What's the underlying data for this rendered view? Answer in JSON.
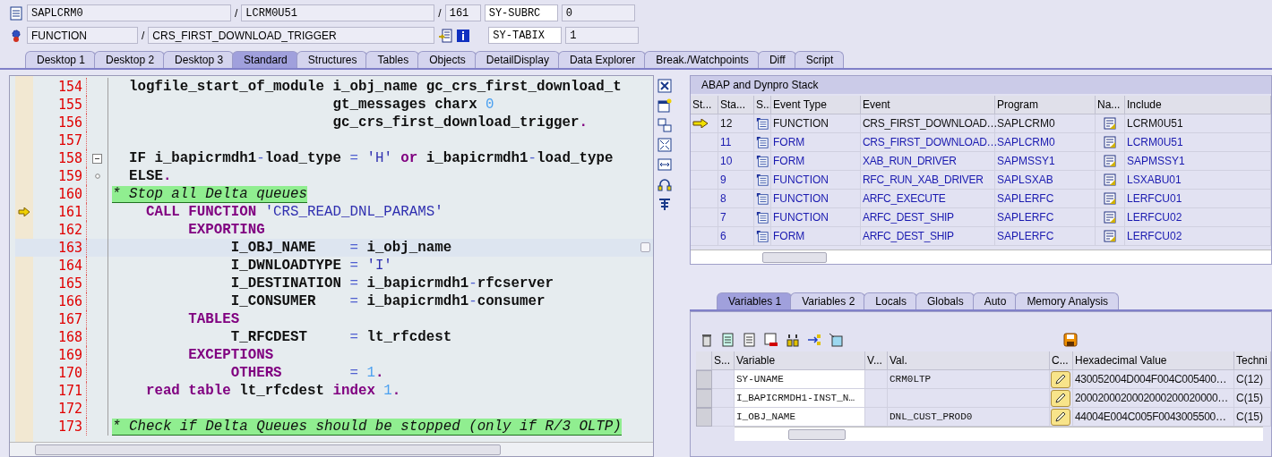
{
  "header": {
    "program": "SAPLCRM0",
    "include": "LCRM0U51",
    "line": "161",
    "sep1": "/",
    "sep2": "/",
    "sep3": "/",
    "event_type": "FUNCTION",
    "event": "CRS_FIRST_DOWNLOAD_TRIGGER",
    "sysvars": [
      {
        "name": "SY-SUBRC",
        "value": "0"
      },
      {
        "name": "SY-TABIX",
        "value": "1"
      }
    ]
  },
  "tabs": [
    {
      "label": "Desktop 1",
      "selected": false
    },
    {
      "label": "Desktop 2",
      "selected": false
    },
    {
      "label": "Desktop 3",
      "selected": false
    },
    {
      "label": "Standard",
      "selected": true
    },
    {
      "label": "Structures",
      "selected": false
    },
    {
      "label": "Tables",
      "selected": false
    },
    {
      "label": "Objects",
      "selected": false
    },
    {
      "label": "DetailDisplay",
      "selected": false
    },
    {
      "label": "Data Explorer",
      "selected": false
    },
    {
      "label": "Break./Watchpoints",
      "selected": false
    },
    {
      "label": "Diff",
      "selected": false
    },
    {
      "label": "Script",
      "selected": false
    }
  ],
  "editor": {
    "lines": [
      {
        "number": "154",
        "current": false,
        "fold_start": false,
        "fold_end": false,
        "selected": false,
        "tokens": [
          {
            "kind": "plain",
            "text": "  logfile_start_of_module i_obj_name gc_crs_first_download_t"
          }
        ]
      },
      {
        "number": "155",
        "current": false,
        "fold_start": false,
        "fold_end": false,
        "selected": false,
        "tokens": [
          {
            "kind": "plain",
            "text": "                          gt_messages charx"
          },
          {
            "kind": "num",
            "text": " 0"
          }
        ]
      },
      {
        "number": "156",
        "current": false,
        "fold_start": false,
        "fold_end": false,
        "selected": false,
        "tokens": [
          {
            "kind": "plain",
            "text": "                          gc_crs_first_download_trigger"
          },
          {
            "kind": "kw",
            "text": "."
          }
        ]
      },
      {
        "number": "157",
        "current": false,
        "fold_start": false,
        "fold_end": false,
        "selected": false
      },
      {
        "number": "158",
        "current": false,
        "fold_start": true,
        "fold_end": false,
        "selected": false,
        "tokens": [
          {
            "kind": "plain",
            "text": "  IF i_bapicrmdh1"
          },
          {
            "kind": "op",
            "text": "-"
          },
          {
            "kind": "plain",
            "text": "load_type"
          },
          {
            "kind": "op",
            "text": " ="
          },
          {
            "kind": "str",
            "text": " 'H'"
          },
          {
            "kind": "kw",
            "text": " or"
          },
          {
            "kind": "plain",
            "text": " i_bapicrmdh1"
          },
          {
            "kind": "op",
            "text": "-"
          },
          {
            "kind": "plain",
            "text": "load_type"
          }
        ]
      },
      {
        "number": "159",
        "current": false,
        "fold_start": false,
        "fold_end": true,
        "selected": false,
        "tokens": [
          {
            "kind": "plain",
            "text": "  ELSE"
          },
          {
            "kind": "kw",
            "text": "."
          }
        ]
      },
      {
        "number": "160",
        "current": false,
        "fold_start": false,
        "fold_end": false,
        "selected": false,
        "tokens": [
          {
            "kind": "comment",
            "text": "* Stop all Delta queues"
          }
        ]
      },
      {
        "number": "161",
        "current": true,
        "fold_start": false,
        "fold_end": false,
        "selected": false,
        "tokens": [
          {
            "kind": "kw",
            "text": "    CALL FUNCTION"
          },
          {
            "kind": "str",
            "text": " 'CRS_READ_DNL_PARAMS'"
          }
        ]
      },
      {
        "number": "162",
        "current": false,
        "fold_start": false,
        "fold_end": false,
        "selected": false,
        "tokens": [
          {
            "kind": "kw",
            "text": "         EXPORTING"
          }
        ]
      },
      {
        "number": "163",
        "current": false,
        "fold_start": false,
        "fold_end": false,
        "selected": true,
        "tokens": [
          {
            "kind": "plain",
            "text": "              I_OBJ_NAME"
          },
          {
            "kind": "op",
            "text": "    ="
          },
          {
            "kind": "plain",
            "text": " i_obj_name"
          }
        ]
      },
      {
        "number": "164",
        "current": false,
        "fold_start": false,
        "fold_end": false,
        "selected": false,
        "tokens": [
          {
            "kind": "plain",
            "text": "              I_DWNLOADTYPE"
          },
          {
            "kind": "op",
            "text": " ="
          },
          {
            "kind": "str",
            "text": " 'I'"
          }
        ]
      },
      {
        "number": "165",
        "current": false,
        "fold_start": false,
        "fold_end": false,
        "selected": false,
        "tokens": [
          {
            "kind": "plain",
            "text": "              I_DESTINATION"
          },
          {
            "kind": "op",
            "text": " ="
          },
          {
            "kind": "plain",
            "text": " i_bapicrmdh1"
          },
          {
            "kind": "op",
            "text": "-"
          },
          {
            "kind": "plain",
            "text": "rfcserver"
          }
        ]
      },
      {
        "number": "166",
        "current": false,
        "fold_start": false,
        "fold_end": false,
        "selected": false,
        "tokens": [
          {
            "kind": "plain",
            "text": "              I_CONSUMER"
          },
          {
            "kind": "op",
            "text": "    ="
          },
          {
            "kind": "plain",
            "text": " i_bapicrmdh1"
          },
          {
            "kind": "op",
            "text": "-"
          },
          {
            "kind": "plain",
            "text": "consumer"
          }
        ]
      },
      {
        "number": "167",
        "current": false,
        "fold_start": false,
        "fold_end": false,
        "selected": false,
        "tokens": [
          {
            "kind": "kw",
            "text": "         TABLES"
          }
        ]
      },
      {
        "number": "168",
        "current": false,
        "fold_start": false,
        "fold_end": false,
        "selected": false,
        "tokens": [
          {
            "kind": "plain",
            "text": "              T_RFCDEST"
          },
          {
            "kind": "op",
            "text": "     ="
          },
          {
            "kind": "plain",
            "text": " lt_rfcdest"
          }
        ]
      },
      {
        "number": "169",
        "current": false,
        "fold_start": false,
        "fold_end": false,
        "selected": false,
        "tokens": [
          {
            "kind": "kw",
            "text": "         EXCEPTIONS"
          }
        ]
      },
      {
        "number": "170",
        "current": false,
        "fold_start": false,
        "fold_end": false,
        "selected": false,
        "tokens": [
          {
            "kind": "kw",
            "text": "              OTHERS"
          },
          {
            "kind": "op",
            "text": "        ="
          },
          {
            "kind": "num",
            "text": " 1"
          },
          {
            "kind": "kw",
            "text": "."
          }
        ]
      },
      {
        "number": "171",
        "current": false,
        "fold_start": false,
        "fold_end": false,
        "selected": false,
        "tokens": [
          {
            "kind": "kw",
            "text": "    read table"
          },
          {
            "kind": "plain",
            "text": " lt_rfcdest"
          },
          {
            "kind": "kw",
            "text": " index"
          },
          {
            "kind": "num",
            "text": " 1"
          },
          {
            "kind": "kw",
            "text": "."
          }
        ]
      },
      {
        "number": "172",
        "current": false,
        "fold_start": false,
        "fold_end": false,
        "selected": false
      },
      {
        "number": "173",
        "current": false,
        "fold_start": false,
        "fold_end": false,
        "selected": false,
        "tokens": [
          {
            "kind": "comment",
            "text": "* Check if Delta Queues should be stopped (only if R/3 OLTP)"
          }
        ]
      }
    ]
  },
  "stack": {
    "title": "ABAP and Dynpro Stack",
    "columns": [
      "St...",
      "Sta...",
      "S...",
      "Event Type",
      "Event",
      "Program",
      "Na...",
      "Include"
    ],
    "rows": [
      {
        "current": true,
        "level": "12",
        "event_type": "FUNCTION",
        "event": "CRS_FIRST_DOWNLOAD…",
        "program": "SAPLCRM0",
        "include": "LCRM0U51"
      },
      {
        "current": false,
        "level": "11",
        "event_type": "FORM",
        "event": "CRS_FIRST_DOWNLOAD…",
        "program": "SAPLCRM0",
        "include": "LCRM0U51"
      },
      {
        "current": false,
        "level": "10",
        "event_type": "FORM",
        "event": "XAB_RUN_DRIVER",
        "program": "SAPMSSY1",
        "include": "SAPMSSY1"
      },
      {
        "current": false,
        "level": "9",
        "event_type": "FUNCTION",
        "event": "RFC_RUN_XAB_DRIVER",
        "program": "SAPLSXAB",
        "include": "LSXABU01"
      },
      {
        "current": false,
        "level": "8",
        "event_type": "FUNCTION",
        "event": "ARFC_EXECUTE",
        "program": "SAPLERFC",
        "include": "LERFCU01"
      },
      {
        "current": false,
        "level": "7",
        "event_type": "FUNCTION",
        "event": "ARFC_DEST_SHIP",
        "program": "SAPLERFC",
        "include": "LERFCU02"
      },
      {
        "current": false,
        "level": "6",
        "event_type": "FORM",
        "event": "ARFC_DEST_SHIP",
        "program": "SAPLERFC",
        "include": "LERFCU02"
      }
    ]
  },
  "variable_tabs": [
    {
      "label": "Variables 1",
      "selected": true
    },
    {
      "label": "Variables 2",
      "selected": false
    },
    {
      "label": "Locals",
      "selected": false
    },
    {
      "label": "Globals",
      "selected": false
    },
    {
      "label": "Auto",
      "selected": false
    },
    {
      "label": "Memory Analysis",
      "selected": false
    }
  ],
  "variables": {
    "columns": [
      "S...",
      "Variable",
      "V...",
      "Val.",
      "C...",
      "Hexadecimal Value",
      "Techni"
    ],
    "rows": [
      {
        "variable": "SY-UNAME",
        "value": "CRM0LTP",
        "hex": "430052004D004F004C005400…",
        "technical": "C(12)"
      },
      {
        "variable": "I_BAPICRMDH1-INST_N…",
        "hex": "2000200020002000200020000…",
        "technical": "C(15)"
      },
      {
        "variable": "I_OBJ_NAME",
        "value": "DNL_CUST_PROD0",
        "hex": "44004E004C005F0043005500…",
        "technical": "C(15)"
      }
    ]
  }
}
